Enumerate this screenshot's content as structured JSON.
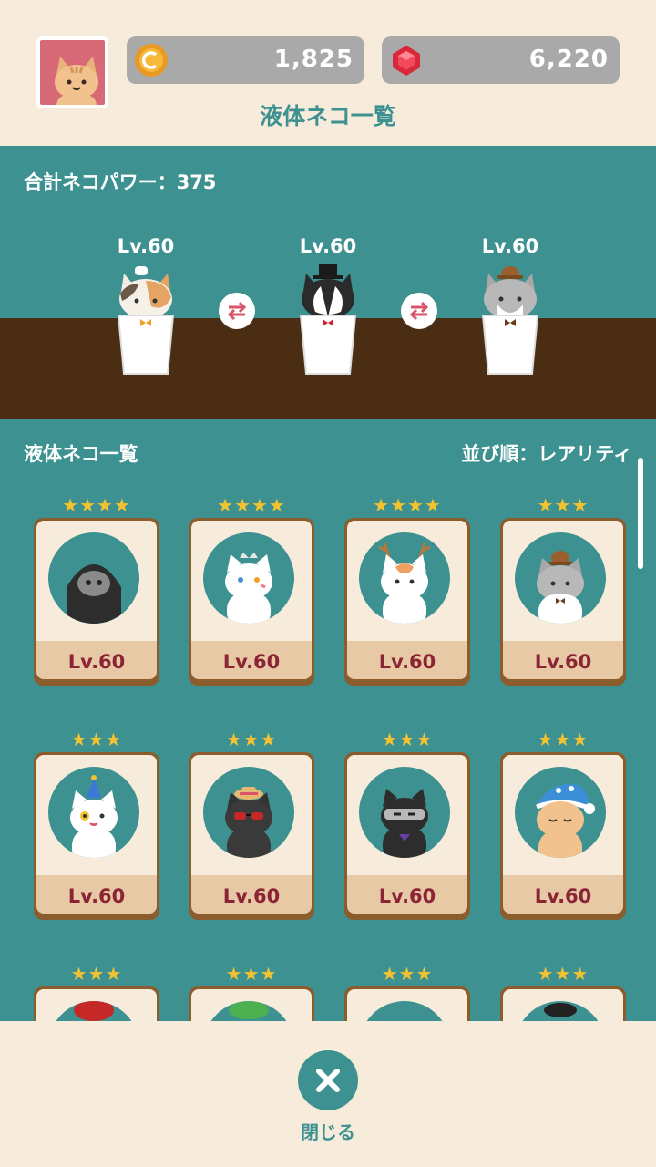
{
  "header": {
    "coins": "1,825",
    "gems": "6,220",
    "title": "液体ネコ一覧"
  },
  "stage": {
    "total_power": "合計ネコパワー：375",
    "slots": [
      {
        "level": "Lv.60",
        "icon": "calico-chef-cat-in-cup"
      },
      {
        "level": "Lv.60",
        "icon": "tuxedo-tophat-cat-in-cup"
      },
      {
        "level": "Lv.60",
        "icon": "gray-bowler-cat-in-cup"
      }
    ]
  },
  "list": {
    "heading": "液体ネコ一覧",
    "sort_label": "並び順：レアリティ",
    "cards": [
      {
        "stars": "★★★★",
        "level": "Lv.60",
        "icon": "grim-reaper-cat"
      },
      {
        "stars": "★★★★",
        "level": "Lv.60",
        "icon": "white-crown-cat"
      },
      {
        "stars": "★★★★",
        "level": "Lv.60",
        "icon": "reindeer-cat"
      },
      {
        "stars": "★★★",
        "level": "Lv.60",
        "icon": "gray-bowler-cat"
      },
      {
        "stars": "★★★",
        "level": "Lv.60",
        "icon": "party-hat-cat"
      },
      {
        "stars": "★★★",
        "level": "Lv.60",
        "icon": "sunglasses-cat"
      },
      {
        "stars": "★★★",
        "level": "Lv.60",
        "icon": "ninja-cat"
      },
      {
        "stars": "★★★",
        "level": "Lv.60",
        "icon": "sleepy-nightcap-cat"
      },
      {
        "stars": "★★★",
        "level": "",
        "icon": "mushroom-cat"
      },
      {
        "stars": "★★★",
        "level": "",
        "icon": "green-hat-cat"
      },
      {
        "stars": "★★★",
        "level": "",
        "icon": "unknown-cat"
      },
      {
        "stars": "★★★",
        "level": "",
        "icon": "dark-cat"
      }
    ]
  },
  "footer": {
    "close_label": "閉じる"
  },
  "colors": {
    "teal": "#3d9191",
    "cream": "#f7ecdb",
    "floor": "#4a2d13",
    "level_text": "#8b2434",
    "star": "#f2c230"
  }
}
